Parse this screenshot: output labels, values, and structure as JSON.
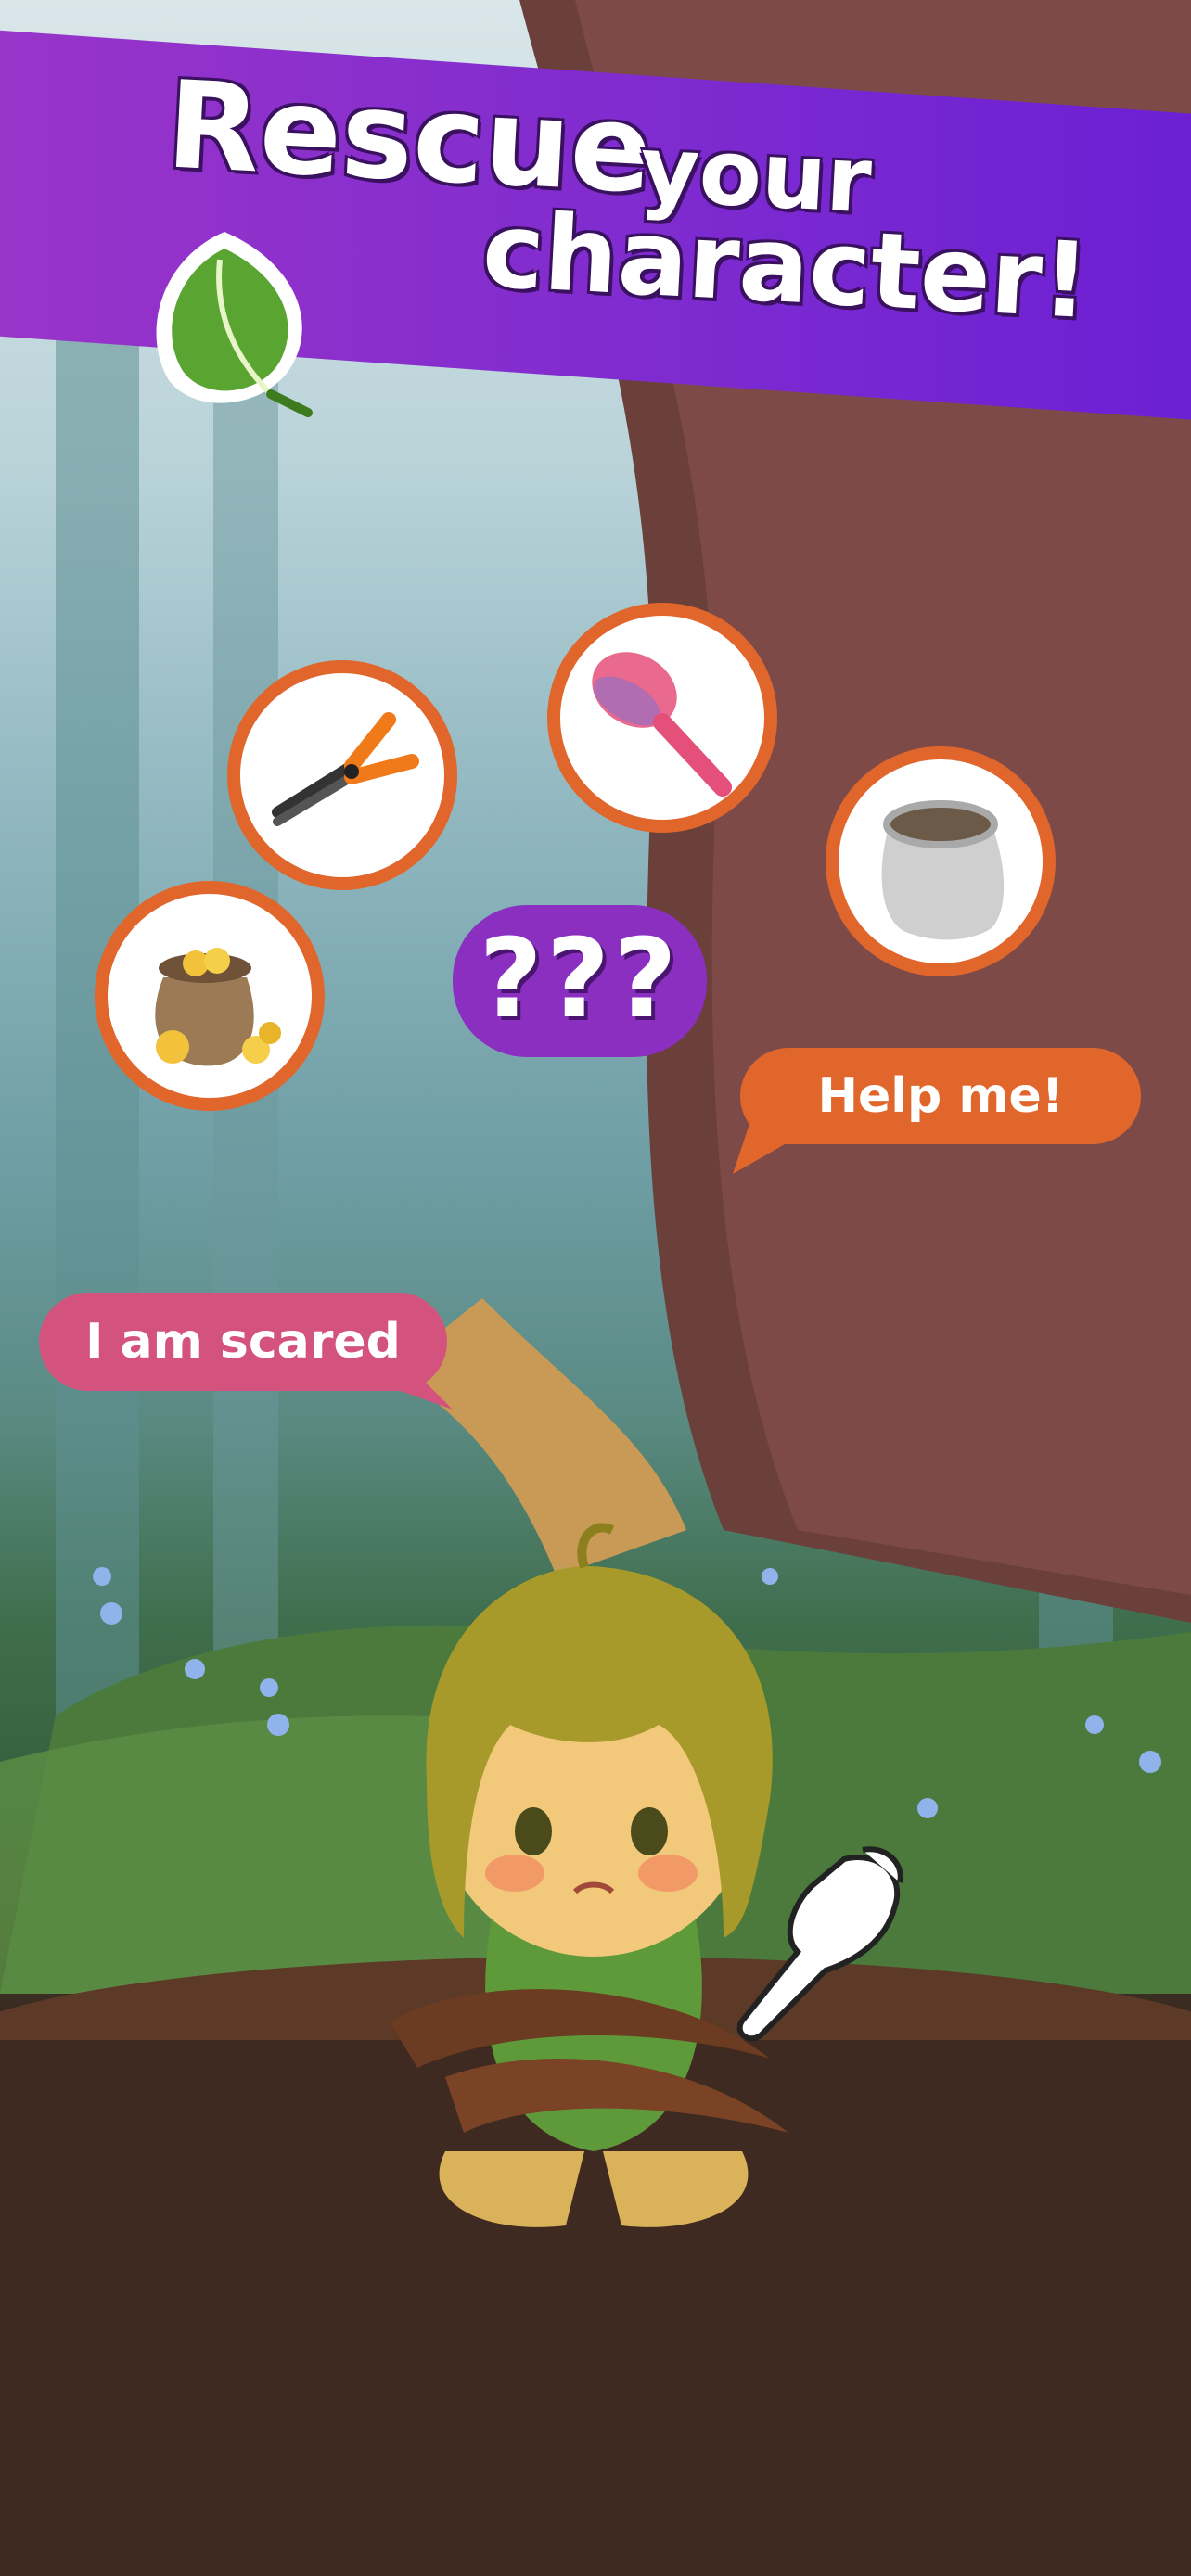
{
  "banner": {
    "title_line1": "Rescue",
    "title_line2": "your",
    "title_line3": "character!"
  },
  "items": [
    {
      "name": "pruning-shears",
      "icon": "pruning-shears-icon"
    },
    {
      "name": "hair-brush",
      "icon": "hair-brush-icon"
    },
    {
      "name": "sack",
      "icon": "empty-sack-icon"
    },
    {
      "name": "gold-coins-bag",
      "icon": "gold-coin-bag-icon"
    }
  ],
  "mystery": {
    "label": "???"
  },
  "speech": {
    "help": "Help me!",
    "scared": "I am scared"
  },
  "colors": {
    "banner": "#7e2bd0",
    "item_border": "#e0662c",
    "help_bubble": "#e0662c",
    "scared_bubble": "#d4537e",
    "mystery": "#8a2fbf"
  }
}
